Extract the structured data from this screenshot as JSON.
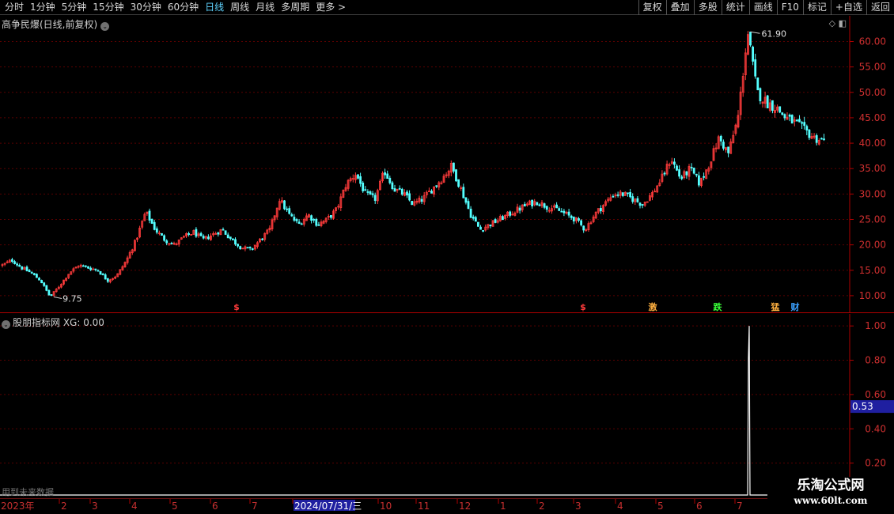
{
  "toolbar": {
    "left_items": [
      "分时",
      "1分钟",
      "5分钟",
      "15分钟",
      "30分钟",
      "60分钟",
      "日线",
      "周线",
      "月线",
      "多周期",
      "更多 >"
    ],
    "active_item": "日线",
    "right_buttons": [
      "复权",
      "叠加",
      "多股",
      "统计",
      "画线",
      "F10",
      "标记",
      "+自选",
      "返回"
    ]
  },
  "main_pane": {
    "title": "高争民爆(日线,前复权)",
    "title_arrow": "chevron-down-icon",
    "max_label": "61.90",
    "min_label": "9.75"
  },
  "indicator_pane": {
    "title": "股朋指标网 XG: 0.00",
    "current_value_tag": "0.53",
    "future_note": "用到未来数据"
  },
  "colors": {
    "up": "#ff3b3b",
    "down": "#54ffff",
    "axis": "#b00000",
    "grid": "#5a0000",
    "accent_active": "#5fd4ff",
    "value_tag_bg": "#1f1fa0"
  },
  "watermark": {
    "title": "乐淘公式网",
    "url": "www.60lt.com"
  },
  "chart_data": [
    {
      "type": "candlestick",
      "title": "高争民爆(日线,前复权)",
      "y_ticks": [
        10,
        15,
        20,
        25,
        30,
        35,
        40,
        45,
        50,
        55,
        60
      ],
      "y_tick_labels": [
        "10.00",
        "15.00",
        "20.00",
        "25.00",
        "30.00",
        "35.00",
        "40.00",
        "45.00",
        "50.00",
        "55.00",
        "60.00"
      ],
      "ylim": [
        7.5,
        63.5
      ],
      "grid": true,
      "close_path": [
        16.0,
        17.0,
        15.5,
        14.5,
        13.0,
        9.75,
        12.0,
        14.5,
        16.0,
        15.5,
        15.0,
        13.0,
        14.0,
        17.0,
        21.0,
        26.5,
        23.0,
        21.0,
        20.0,
        21.5,
        22.5,
        21.0,
        22.0,
        23.0,
        21.0,
        19.5,
        19.0,
        21.0,
        23.0,
        29.0,
        26.0,
        24.0,
        26.0,
        24.0,
        25.0,
        27.0,
        32.0,
        34.0,
        30.0,
        29.0,
        34.5,
        31.0,
        30.0,
        28.0,
        29.0,
        31.0,
        33.0,
        35.5,
        31.0,
        26.0,
        23.0,
        24.0,
        25.0,
        26.0,
        27.0,
        28.0,
        28.5,
        27.5,
        27.0,
        26.0,
        25.0,
        23.0,
        26.0,
        28.0,
        30.0,
        30.0,
        29.0,
        28.0,
        30.0,
        33.0,
        37.0,
        33.0,
        35.0,
        32.0,
        36.0,
        41.0,
        38.0,
        45.0,
        61.9,
        50.0,
        48.0,
        47.0,
        45.0,
        44.0,
        42.5,
        41.0,
        40.5
      ],
      "annotations": {
        "max": {
          "value": 61.9,
          "label": "61.90"
        },
        "min": {
          "value": 9.75,
          "label": "9.75"
        },
        "event_marks": [
          "$",
          "$",
          "激",
          "跌",
          "猛",
          "财"
        ]
      },
      "event_mark_colors": [
        "#ff3b3b",
        "#ff3b3b",
        "#ffb040",
        "#38ff38",
        "#ffb040",
        "#3aa0ff"
      ],
      "x_labels": [
        "2023年",
        "2",
        "3",
        "4",
        "5",
        "6",
        "7",
        "2024/07/31/三",
        "10",
        "11",
        "12",
        "1",
        "2",
        "3",
        "4",
        "5",
        "6",
        "7"
      ],
      "x_label_positions": [
        1,
        77,
        116,
        166,
        217,
        268,
        318,
        372,
        480,
        528,
        580,
        632,
        681,
        727,
        780,
        831,
        880,
        931
      ],
      "x_highlight": "2024/07/31/三"
    },
    {
      "type": "line",
      "title": "XG",
      "y_ticks": [
        0.2,
        0.4,
        0.6,
        0.8,
        1.0
      ],
      "y_tick_labels": [
        "0.20",
        "0.40",
        "0.60",
        "0.80",
        "1.00"
      ],
      "ylim": [
        0.0,
        1.07
      ],
      "current_value": 0.53,
      "signal": {
        "value": 1.0,
        "note": "single spike near the 61.90 peak"
      }
    }
  ]
}
